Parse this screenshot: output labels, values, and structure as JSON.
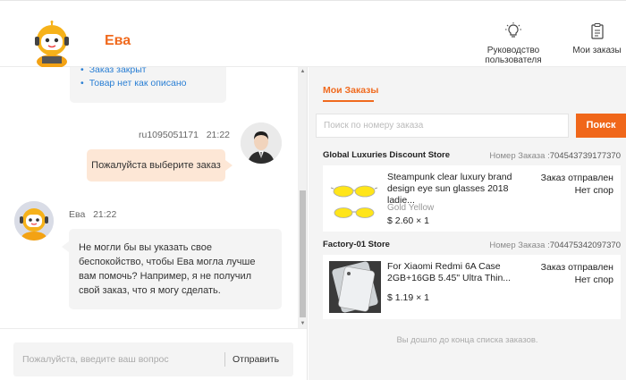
{
  "header": {
    "agent_name": "Ева",
    "guide_label": "Руководство пользователя",
    "orders_label": "Мои заказы"
  },
  "chat": {
    "top_bubble": {
      "items": [
        "Заказ закрыт",
        "Товар нет как описано"
      ]
    },
    "user_message": {
      "sender": "ru1095051171",
      "time": "21:22",
      "text": "Пожалуйста выберите заказ"
    },
    "bot_message": {
      "sender": "Ева",
      "time": "21:22",
      "text": "Не могли бы вы указать свое беспокойство, чтобы Ева могла лучше вам помочь? Например, я не получил свой заказ, что я могу сделать."
    },
    "input": {
      "placeholder": "Пожалуйста, введите ваш вопрос",
      "send_label": "Отправить"
    }
  },
  "orders": {
    "tab_label": "Мои Заказы",
    "search_placeholder": "Поиск по номеру заказа",
    "search_button": "Поиск",
    "list": [
      {
        "store": "Global Luxuries Discount Store",
        "order_label": "Номер Заказа :",
        "order_number": "704543739177370",
        "title": "Steampunk clear luxury brand design eye sun glasses 2018 ladie...",
        "variant": "Gold Yellow",
        "price": "$ 2.60 × 1",
        "status_line1": "Заказ отправлен",
        "status_line2": "Нет спор"
      },
      {
        "store": "Factory-01 Store",
        "order_label": "Номер Заказа :",
        "order_number": "704475342097370",
        "title": "For Xiaomi Redmi 6A Case 2GB+16GB 5.45\" Ultra Thin...",
        "variant": "",
        "price": "$ 1.19 × 1",
        "status_line1": "Заказ отправлен",
        "status_line2": "Нет спор"
      }
    ],
    "end_note": "Вы дошло до конца списка заказов."
  },
  "colors": {
    "accent": "#f06a1e",
    "link": "#2a7fd4",
    "user_bubble": "#fde7d6"
  },
  "icons": {
    "guide": "lightbulb-icon",
    "orders": "clipboard-icon"
  }
}
